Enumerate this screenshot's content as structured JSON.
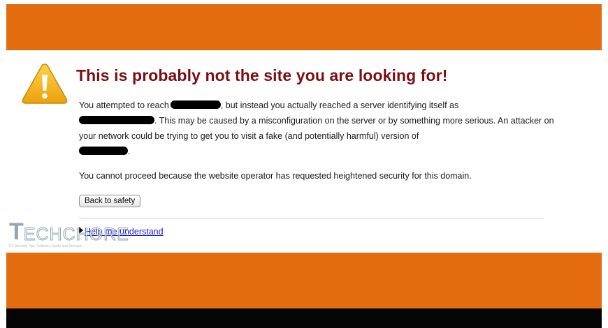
{
  "colors": {
    "band": "#e36d0e",
    "title": "#7b0f12",
    "link": "#1a1acf",
    "warning_fill": "#f5b316"
  },
  "icons": {
    "warning": "warning-triangle-icon",
    "disclosure": "disclosure-triangle-icon"
  },
  "error_page": {
    "title": "This is probably not the site you are looking for!",
    "paragraph1": {
      "part1": "You attempted to reach",
      "part2": ", but instead you actually reached a server identifying itself as",
      "part3": ". This may be caused by a misconfiguration on the server or by something more serious. An attacker on your network could be trying to get you to visit a fake (and potentially harmful) version of",
      "part4": "."
    },
    "paragraph2": "You cannot proceed because the website operator has requested heightened security for this domain.",
    "back_button_label": "Back to safety",
    "help_link_label": "Help me understand"
  },
  "watermark": {
    "logo_first": "T",
    "logo_rest": "ECHCHORE",
    "tagline": "PC Security Tips, Software Guide and Reviews"
  }
}
